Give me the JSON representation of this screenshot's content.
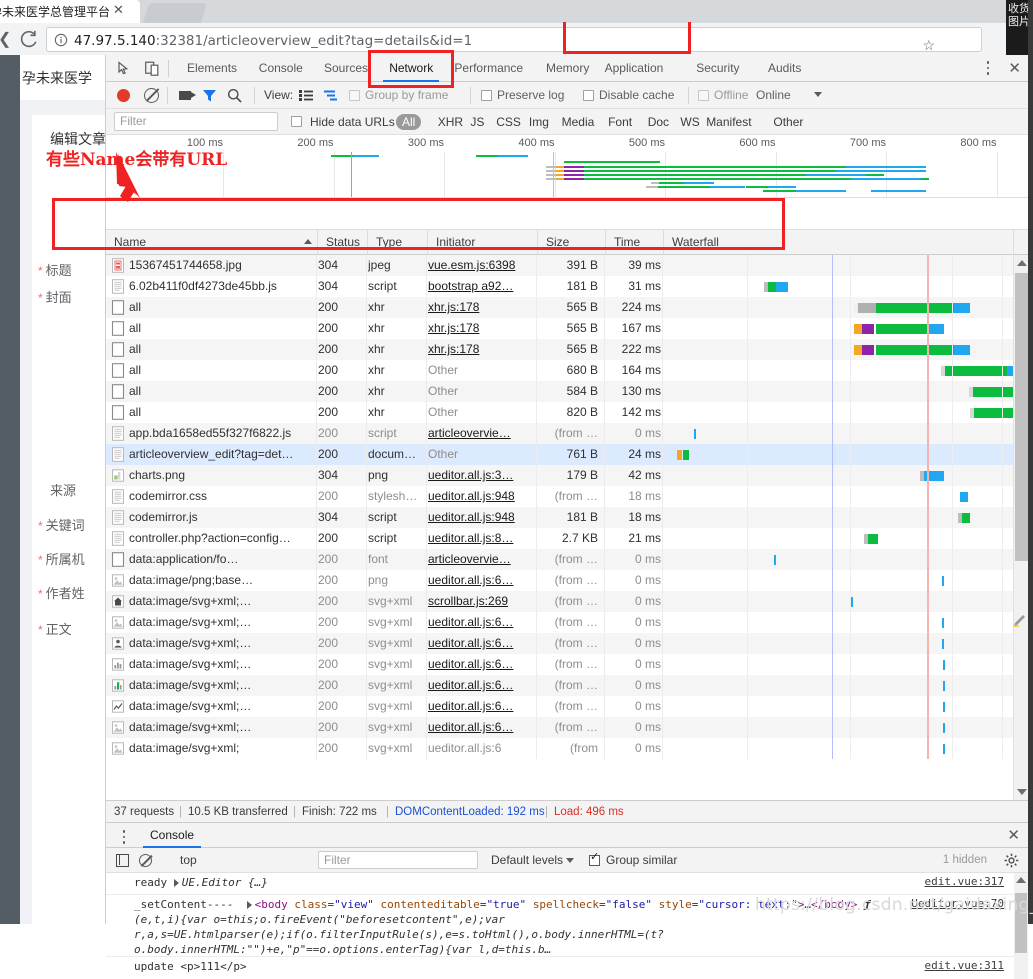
{
  "browser": {
    "tab_title": "孕未来医学总管理平台",
    "tab_close": "✕",
    "url_host": "47.97.5.140",
    "url_rest": ":32381/articleoverview_edit?tag=details&id=1",
    "star": "☆"
  },
  "page_behind": {
    "brand": "孕未来医学",
    "card_title": "编辑文章",
    "form_labels": [
      {
        "required": true,
        "text": "标题"
      },
      {
        "required": true,
        "text": "封面"
      },
      {
        "required": false,
        "text": "来源"
      },
      {
        "required": true,
        "text": "关键词"
      },
      {
        "required": true,
        "text": "所属机"
      },
      {
        "required": true,
        "text": "作者姓"
      },
      {
        "required": true,
        "text": "正文"
      }
    ]
  },
  "devtools": {
    "tabs": [
      {
        "label": "Elements",
        "active": false
      },
      {
        "label": "Console",
        "active": false
      },
      {
        "label": "Sources",
        "active": false
      },
      {
        "label": "Network",
        "active": true
      },
      {
        "label": "Performance",
        "active": false
      },
      {
        "label": "Memory",
        "active": false
      },
      {
        "label": "Application",
        "active": false
      },
      {
        "label": "Security",
        "active": false
      },
      {
        "label": "Audits",
        "active": false
      }
    ],
    "controls": {
      "view_label": "View:",
      "group_by_frame": "Group by frame",
      "preserve_log": "Preserve log",
      "disable_cache": "Disable cache",
      "offline": "Offline",
      "online": "Online"
    },
    "filterbar": {
      "filter_placeholder": "Filter",
      "hide_data_urls": "Hide data URLs",
      "types": [
        "All",
        "XHR",
        "JS",
        "CSS",
        "Img",
        "Media",
        "Font",
        "Doc",
        "WS",
        "Manifest",
        "Other"
      ],
      "selected_type": "All"
    },
    "overview": {
      "ticks": [
        "100 ms",
        "200 ms",
        "300 ms",
        "400 ms",
        "500 ms",
        "600 ms",
        "700 ms",
        "800 ms"
      ]
    },
    "columns": [
      "Name",
      "Status",
      "Type",
      "Initiator",
      "Size",
      "Time",
      "Waterfall"
    ],
    "sort_column": "Name",
    "rows": [
      {
        "icon": "jpeg-file-icon",
        "name": "15367451744658.jpg",
        "status": "304",
        "type": "jpeg",
        "initiator": "vue.esm.js:6398",
        "initiator_link": true,
        "size": "391 B",
        "time": "39 ms",
        "dim": false,
        "selected": false
      },
      {
        "icon": "script-file-icon",
        "name": "6.02b411f0df4273de45bb.js",
        "status": "304",
        "type": "script",
        "initiator": "bootstrap a92…",
        "initiator_link": true,
        "size": "181 B",
        "time": "31 ms",
        "dim": false,
        "selected": false
      },
      {
        "icon": "blank-file-icon",
        "name": "all",
        "status": "200",
        "type": "xhr",
        "initiator": "xhr.js:178",
        "initiator_link": true,
        "size": "565 B",
        "time": "224 ms",
        "dim": false,
        "selected": false
      },
      {
        "icon": "blank-file-icon",
        "name": "all",
        "status": "200",
        "type": "xhr",
        "initiator": "xhr.js:178",
        "initiator_link": true,
        "size": "565 B",
        "time": "167 ms",
        "dim": false,
        "selected": false
      },
      {
        "icon": "blank-file-icon",
        "name": "all",
        "status": "200",
        "type": "xhr",
        "initiator": "xhr.js:178",
        "initiator_link": true,
        "size": "565 B",
        "time": "222 ms",
        "dim": false,
        "selected": false
      },
      {
        "icon": "blank-file-icon",
        "name": "all",
        "status": "200",
        "type": "xhr",
        "initiator": "Other",
        "initiator_link": false,
        "size": "680 B",
        "time": "164 ms",
        "dim": false,
        "selected": false
      },
      {
        "icon": "blank-file-icon",
        "name": "all",
        "status": "200",
        "type": "xhr",
        "initiator": "Other",
        "initiator_link": false,
        "size": "584 B",
        "time": "130 ms",
        "dim": false,
        "selected": false
      },
      {
        "icon": "blank-file-icon",
        "name": "all",
        "status": "200",
        "type": "xhr",
        "initiator": "Other",
        "initiator_link": false,
        "size": "820 B",
        "time": "142 ms",
        "dim": false,
        "selected": false
      },
      {
        "icon": "script-file-icon",
        "name": "app.bda1658ed55f327f6822.js",
        "status": "200",
        "type": "script",
        "initiator": "articleovervie…",
        "initiator_link": true,
        "size": "(from …",
        "time": "0 ms",
        "dim": true,
        "selected": false
      },
      {
        "icon": "doc-file-icon",
        "name": "articleoverview_edit?tag=det…",
        "status": "200",
        "type": "docum…",
        "initiator": "Other",
        "initiator_link": false,
        "size": "761 B",
        "time": "24 ms",
        "dim": false,
        "selected": true
      },
      {
        "icon": "png-file-icon",
        "name": "charts.png",
        "status": "304",
        "type": "png",
        "initiator": "ueditor.all.js:3…",
        "initiator_link": true,
        "size": "179 B",
        "time": "42 ms",
        "dim": false,
        "selected": false
      },
      {
        "icon": "script-file-icon",
        "name": "codemirror.css",
        "status": "200",
        "type": "stylesh…",
        "initiator": "ueditor.all.js:948",
        "initiator_link": true,
        "size": "(from …",
        "time": "18 ms",
        "dim": true,
        "selected": false
      },
      {
        "icon": "script-file-icon",
        "name": "codemirror.js",
        "status": "304",
        "type": "script",
        "initiator": "ueditor.all.js:948",
        "initiator_link": true,
        "size": "181 B",
        "time": "18 ms",
        "dim": false,
        "selected": false
      },
      {
        "icon": "script-file-icon",
        "name": "controller.php?action=config…",
        "status": "200",
        "type": "script",
        "initiator": "ueditor.all.js:8…",
        "initiator_link": true,
        "size": "2.7 KB",
        "time": "21 ms",
        "dim": false,
        "selected": false
      },
      {
        "icon": "blank-file-icon",
        "name": "data:application/fo…",
        "status": "200",
        "type": "font",
        "initiator": "articleovervie…",
        "initiator_link": true,
        "size": "(from …",
        "time": "0 ms",
        "dim": true,
        "selected": false
      },
      {
        "icon": "image-gray-icon",
        "name": "data:image/png;base…",
        "status": "200",
        "type": "png",
        "initiator": "ueditor.all.js:6…",
        "initiator_link": true,
        "size": "(from …",
        "time": "0 ms",
        "dim": true,
        "selected": false
      },
      {
        "icon": "home-icon",
        "name": "data:image/svg+xml;…",
        "status": "200",
        "type": "svg+xml",
        "initiator": "scrollbar.js:269",
        "initiator_link": true,
        "size": "(from …",
        "time": "0 ms",
        "dim": true,
        "selected": false
      },
      {
        "icon": "image-gray-icon",
        "name": "data:image/svg+xml;…",
        "status": "200",
        "type": "svg+xml",
        "initiator": "ueditor.all.js:6…",
        "initiator_link": true,
        "size": "(from …",
        "time": "0 ms",
        "dim": true,
        "selected": false
      },
      {
        "icon": "person-icon",
        "name": "data:image/svg+xml;…",
        "status": "200",
        "type": "svg+xml",
        "initiator": "ueditor.all.js:6…",
        "initiator_link": true,
        "size": "(from …",
        "time": "0 ms",
        "dim": true,
        "selected": false
      },
      {
        "icon": "barchart-icon",
        "name": "data:image/svg+xml;…",
        "status": "200",
        "type": "svg+xml",
        "initiator": "ueditor.all.js:6…",
        "initiator_link": true,
        "size": "(from …",
        "time": "0 ms",
        "dim": true,
        "selected": false
      },
      {
        "icon": "barchart-green-icon",
        "name": "data:image/svg+xml;…",
        "status": "200",
        "type": "svg+xml",
        "initiator": "ueditor.all.js:6…",
        "initiator_link": true,
        "size": "(from …",
        "time": "0 ms",
        "dim": true,
        "selected": false
      },
      {
        "icon": "linechart-icon",
        "name": "data:image/svg+xml;…",
        "status": "200",
        "type": "svg+xml",
        "initiator": "ueditor.all.js:6…",
        "initiator_link": true,
        "size": "(from …",
        "time": "0 ms",
        "dim": true,
        "selected": false
      },
      {
        "icon": "image-gray-icon",
        "name": "data:image/svg+xml;…",
        "status": "200",
        "type": "svg+xml",
        "initiator": "ueditor.all.js:6…",
        "initiator_link": true,
        "size": "(from …",
        "time": "0 ms",
        "dim": true,
        "selected": false
      },
      {
        "icon": "image-gray-icon",
        "name": "data:image/svg+xml;",
        "status": "200",
        "type": "svg+xml",
        "initiator": "ueditor.all.js:6",
        "initiator_link": false,
        "size": "(from",
        "time": "0 ms",
        "dim": true,
        "selected": false
      }
    ],
    "status_bar": {
      "requests": "37 requests",
      "transferred": "10.5 KB transferred",
      "finish": "Finish: 722 ms",
      "dcl": "DOMContentLoaded: 192 ms",
      "load": "Load: 496 ms",
      "sep": "|"
    }
  },
  "console_drawer": {
    "tab": "Console",
    "close": "✕",
    "context": "top",
    "filter_placeholder": "Filter",
    "levels": "Default levels",
    "group_similar": "Group similar",
    "hidden": "1 hidden",
    "entries": [
      {
        "label": "ready",
        "value": "UE.Editor {…}",
        "source": "edit.vue:317"
      },
      {
        "label": "_setContent----",
        "value": "<body class=\"view\" contenteditable=\"true\" spellcheck=\"false\" style=\"cursor: text;\">…</body>",
        "fn": "ƒ",
        "body": "(e,t,i){var o=this;o.fireEvent(\"beforesetcontent\",e);var r,a,s=UE.htmlparser(e);if(o.filterInputRule(s),e=s.toHtml(),o.body.innerHTML=(t?o.body.innerHTML:\"\")+e,\"p\"==o.options.enterTag){var l,d=this.b…",
        "source": "Ueditor.vue:70"
      },
      {
        "label": "update",
        "value": "<p>111</p>",
        "source": "edit.vue:311"
      }
    ]
  },
  "annotations": {
    "callout_text": "有些Name会带有URL",
    "watermark": "https://blog.csdn.net/gaidaxing_dashu",
    "accent_red": "#ee2222"
  },
  "right_panel": {
    "line1": "收货",
    "line2": "图片"
  }
}
